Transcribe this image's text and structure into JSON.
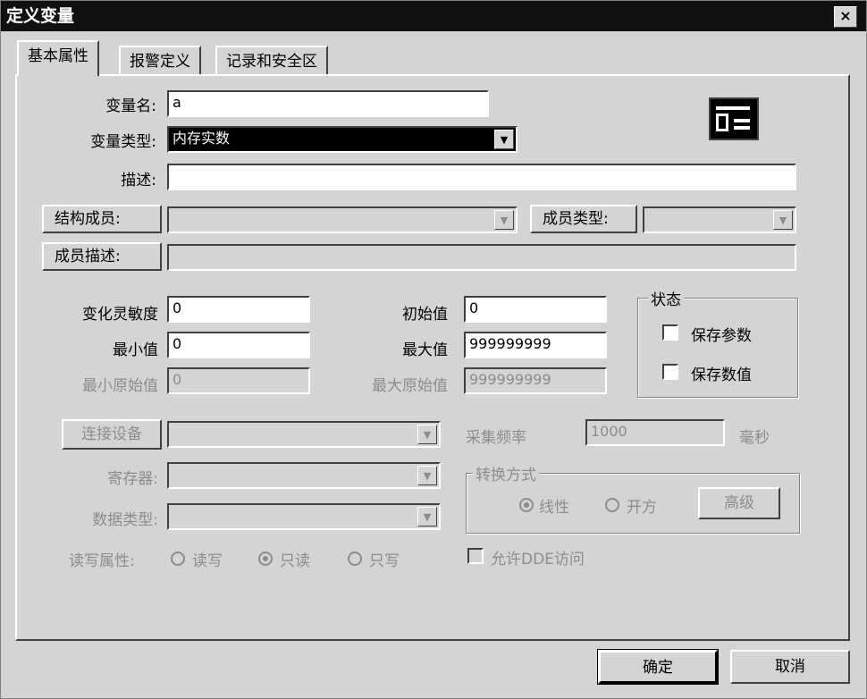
{
  "window": {
    "title": "定义变量",
    "close_glyph": "×"
  },
  "tabs": [
    {
      "label": "基本属性",
      "active": true
    },
    {
      "label": "报警定义",
      "active": false
    },
    {
      "label": "记录和安全区",
      "active": false
    }
  ],
  "form": {
    "var_name_label": "变量名:",
    "var_name_value": "a",
    "var_type_label": "变量类型:",
    "var_type_value": "内存实数",
    "desc_label": "描述:",
    "desc_value": "",
    "struct_member_label": "结构成员:",
    "member_type_label": "成员类型:",
    "member_desc_label": "成员描述:",
    "sensitivity_label": "变化灵敏度",
    "sensitivity_value": "0",
    "init_label": "初始值",
    "init_value": "0",
    "min_label": "最小值",
    "min_value": "0",
    "max_label": "最大值",
    "max_value": "999999999",
    "min_raw_label": "最小原始值",
    "min_raw_value": "0",
    "max_raw_label": "最大原始值",
    "max_raw_value": "999999999",
    "state_legend": "状态",
    "save_params_label": "保存参数",
    "save_value_label": "保存数值",
    "device_button": "连接设备",
    "sample_label": "采集频率",
    "sample_value": "1000",
    "sample_unit": "毫秒",
    "register_label": "寄存器:",
    "datatype_label": "数据类型:",
    "convert_legend": "转换方式",
    "linear_label": "线性",
    "sqrt_label": "开方",
    "advanced_button": "高级",
    "rw_label": "读写属性:",
    "rw_readwrite": "读写",
    "rw_readonly": "只读",
    "rw_writeonly": "只写",
    "dde_label": "允许DDE访问"
  },
  "buttons": {
    "ok": "确定",
    "cancel": "取消"
  }
}
